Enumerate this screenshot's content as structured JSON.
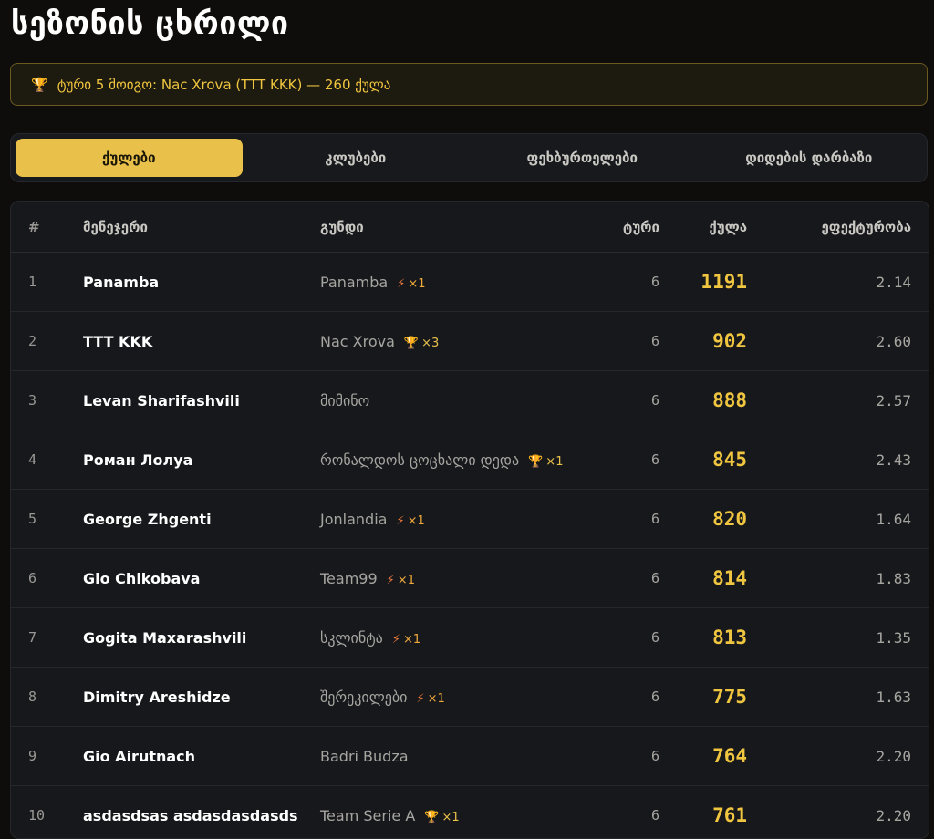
{
  "page": {
    "title": "სეზონის ცხრილი"
  },
  "banner": {
    "icon": "trophy-icon",
    "text": "ტური 5 მოიგო: Nac Xrova (TTT KKK) — 260 ქულა"
  },
  "tabs": [
    {
      "label": "ქულები",
      "active": true
    },
    {
      "label": "კლუბები",
      "active": false
    },
    {
      "label": "ფეხბურთელები",
      "active": false
    },
    {
      "label": "დიდების დარბაზი",
      "active": false
    }
  ],
  "table": {
    "headers": {
      "rank": "#",
      "manager": "მენეჯერი",
      "team": "გუნდი",
      "tour": "ტური",
      "points": "ქულა",
      "efficiency": "ეფექტურობა"
    },
    "rows": [
      {
        "rank": "1",
        "manager": "Panamba",
        "team": "Panamba",
        "badge": {
          "icon": "bolt-icon",
          "count": "×1"
        },
        "tour": "6",
        "points": "1191",
        "efficiency": "2.14"
      },
      {
        "rank": "2",
        "manager": "TTT KKK",
        "team": "Nac Xrova",
        "badge": {
          "icon": "trophy-icon",
          "count": "×3"
        },
        "tour": "6",
        "points": "902",
        "efficiency": "2.60"
      },
      {
        "rank": "3",
        "manager": "Levan Sharifashvili",
        "team": "მიმინო",
        "badge": null,
        "tour": "6",
        "points": "888",
        "efficiency": "2.57"
      },
      {
        "rank": "4",
        "manager": "Роман Лолуа",
        "team": "რონალდოს ცოცხალი დედა",
        "badge": {
          "icon": "trophy-icon",
          "count": "×1"
        },
        "tour": "6",
        "points": "845",
        "efficiency": "2.43"
      },
      {
        "rank": "5",
        "manager": "George Zhgenti",
        "team": "Jonlandia",
        "badge": {
          "icon": "bolt-icon",
          "count": "×1"
        },
        "tour": "6",
        "points": "820",
        "efficiency": "1.64"
      },
      {
        "rank": "6",
        "manager": "Gio Chikobava",
        "team": "Team99",
        "badge": {
          "icon": "bolt-icon",
          "count": "×1"
        },
        "tour": "6",
        "points": "814",
        "efficiency": "1.83"
      },
      {
        "rank": "7",
        "manager": "Gogita Maxarashvili",
        "team": "სკლინტა",
        "badge": {
          "icon": "bolt-icon",
          "count": "×1"
        },
        "tour": "6",
        "points": "813",
        "efficiency": "1.35"
      },
      {
        "rank": "8",
        "manager": "Dimitry Areshidze",
        "team": "შერეკილები",
        "badge": {
          "icon": "bolt-icon",
          "count": "×1"
        },
        "tour": "6",
        "points": "775",
        "efficiency": "1.63"
      },
      {
        "rank": "9",
        "manager": "Gio Airutnach",
        "team": "Badri Budza",
        "badge": null,
        "tour": "6",
        "points": "764",
        "efficiency": "2.20"
      },
      {
        "rank": "10",
        "manager": "asdasdsas asdasdasdasds",
        "team": "Team Serie A",
        "badge": {
          "icon": "trophy-icon",
          "count": "×1"
        },
        "tour": "6",
        "points": "761",
        "efficiency": "2.20"
      }
    ]
  },
  "colors": {
    "accent": "#e8c04a",
    "background": "#0e0d0b",
    "bolt": "#f07a3a"
  }
}
